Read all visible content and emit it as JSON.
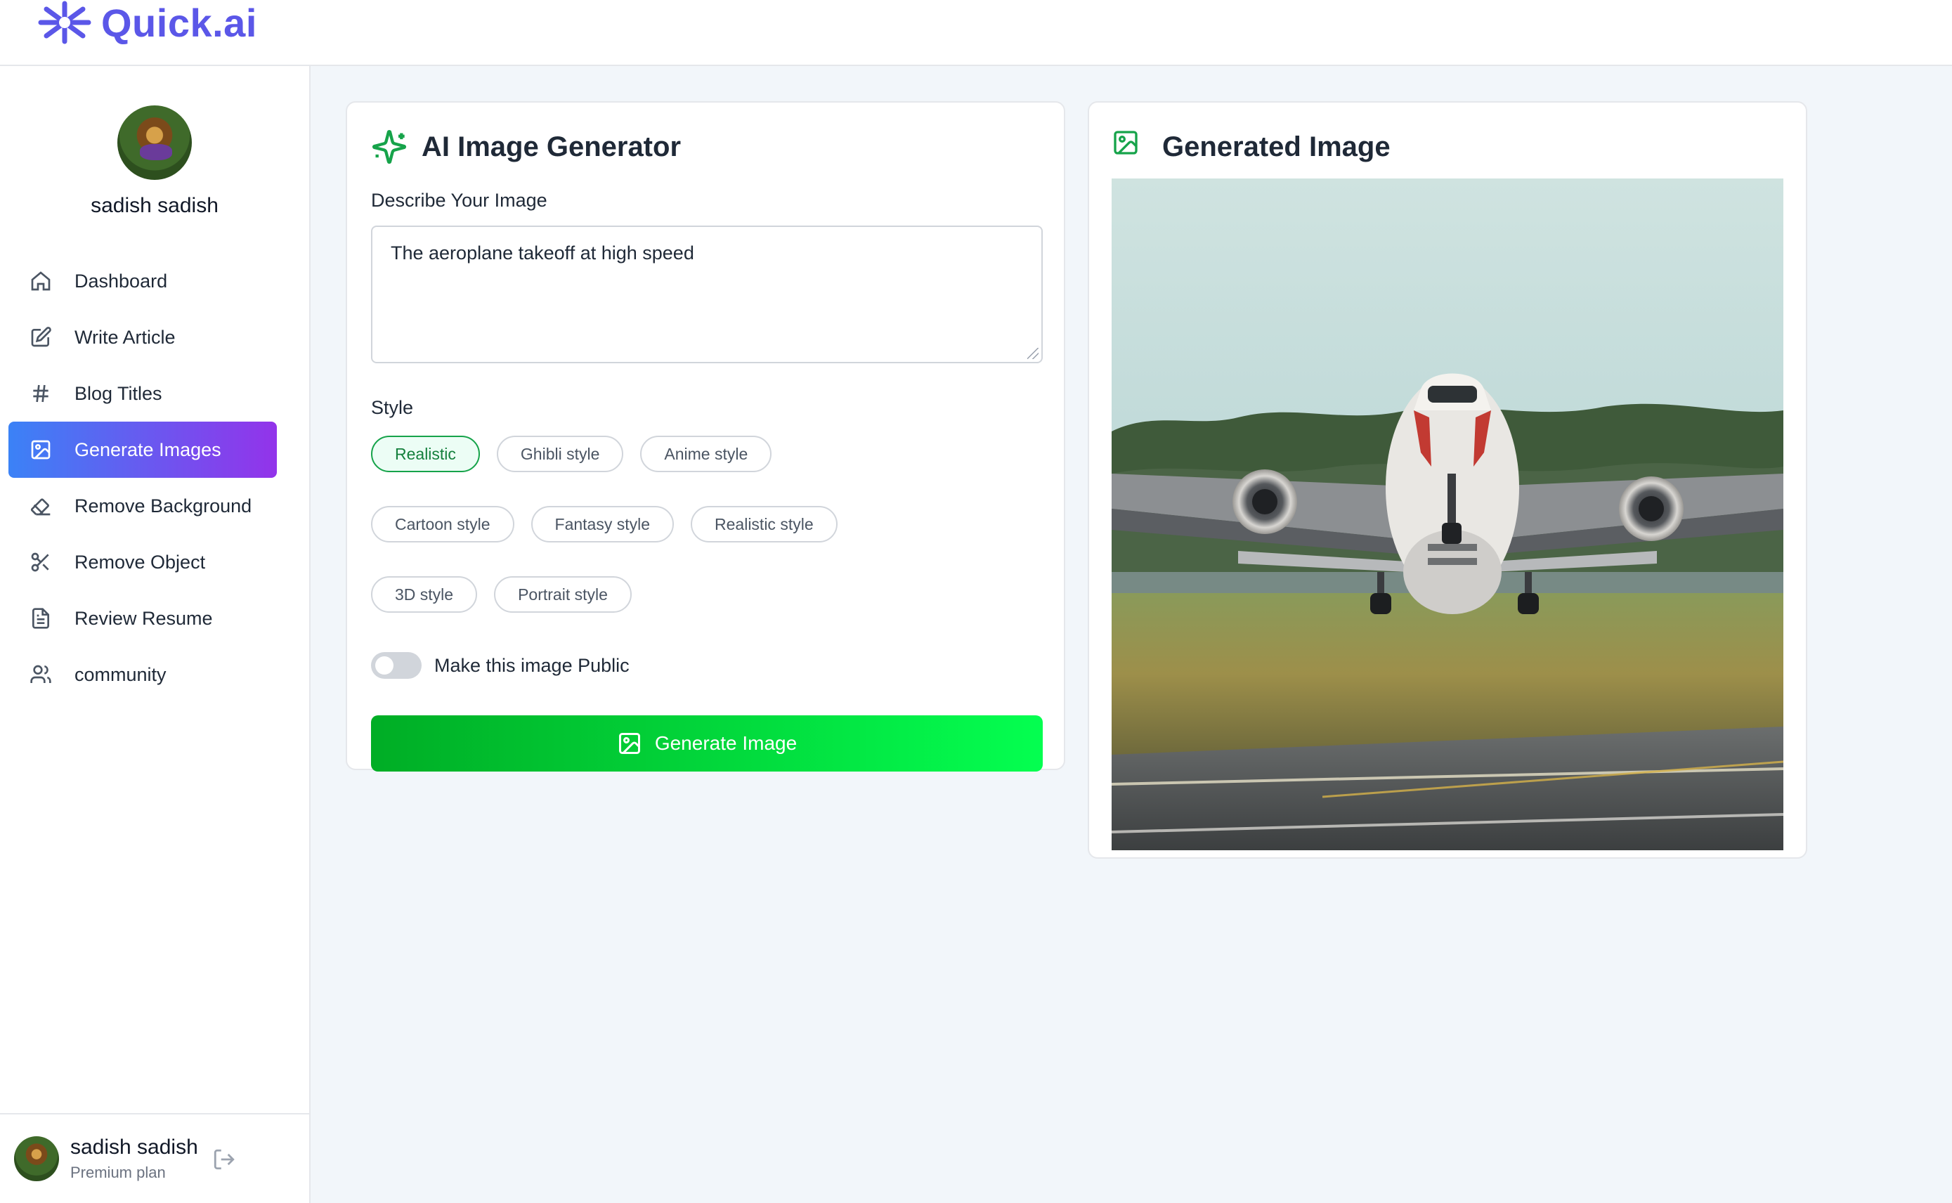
{
  "app": {
    "name": "Quick.ai",
    "brand_color": "#5b57e8"
  },
  "sidebar": {
    "user_name": "sadish sadish",
    "items": [
      {
        "label": "Dashboard",
        "icon": "home-icon"
      },
      {
        "label": "Write Article",
        "icon": "edit-icon"
      },
      {
        "label": "Blog Titles",
        "icon": "hash-icon"
      },
      {
        "label": "Generate Images",
        "icon": "image-icon",
        "active": true
      },
      {
        "label": "Remove Background",
        "icon": "eraser-icon"
      },
      {
        "label": "Remove Object",
        "icon": "scissors-icon"
      },
      {
        "label": "Review Resume",
        "icon": "file-text-icon"
      },
      {
        "label": "community",
        "icon": "users-icon"
      }
    ],
    "active_gradient": [
      "#3b82f6",
      "#9333ea"
    ],
    "footer": {
      "name": "sadish sadish",
      "plan": "Premium plan"
    }
  },
  "generator": {
    "title": "AI Image Generator",
    "prompt_label": "Describe Your Image",
    "prompt_value": "The aeroplane takeoff at high speed",
    "style_label": "Style",
    "styles": [
      "Realistic",
      "Ghibli style",
      "Anime style",
      "Cartoon style",
      "Fantasy style",
      "Realistic style",
      "3D style",
      "Portrait style"
    ],
    "selected_style": "Realistic",
    "public_toggle_label": "Make this image Public",
    "public_toggle_on": false,
    "button_label": "Generate Image",
    "button_gradient": [
      "#00ad25",
      "#04ff50"
    ]
  },
  "result": {
    "title": "Generated Image",
    "icon": "image-icon",
    "accent": "#16a34a"
  }
}
